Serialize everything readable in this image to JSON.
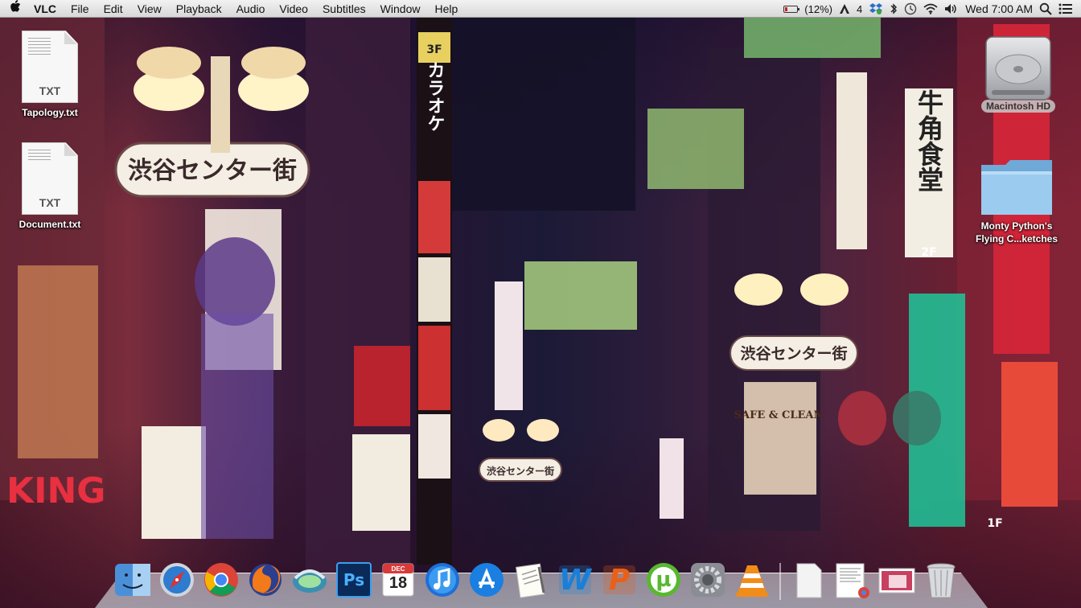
{
  "menubar": {
    "apple_icon": "apple-logo-icon",
    "app_name": "VLC",
    "menus": [
      "File",
      "Edit",
      "View",
      "Playback",
      "Audio",
      "Video",
      "Subtitles",
      "Window",
      "Help"
    ],
    "status": {
      "battery_text": "(12%)",
      "adobe_count": "4",
      "clock": "Wed 7:00 AM"
    }
  },
  "desktop": {
    "files": [
      {
        "ext": "TXT",
        "name": "Tapology.txt"
      },
      {
        "ext": "TXT",
        "name": "Document.txt"
      }
    ],
    "drive": {
      "name": "Macintosh HD"
    },
    "folder": {
      "name_line1": "Monty Python's",
      "name_line2": "Flying C...ketches"
    }
  },
  "wallpaper": {
    "sign_main": "渋谷センター街",
    "sign_karaoke": "カラオケ",
    "sign_safe_clean": "SAFE & CLEAN",
    "sign_king": "KING",
    "sign_gyukaku": "牛角食堂",
    "sign_2f": "2F",
    "sign_3f": "3F",
    "sign_1f": "1F"
  },
  "dock": {
    "apps": [
      "finder-icon",
      "safari-icon",
      "chrome-icon",
      "firefox-icon",
      "sync-icon",
      "photoshop-icon",
      "calendar-icon",
      "itunes-icon",
      "app-store-icon",
      "text-edit-icon",
      "word-icon",
      "powerpoint-icon",
      "utorrent-icon",
      "system-preferences-icon",
      "vlc-icon"
    ],
    "calendar_month": "DEC",
    "calendar_day": "18",
    "ps_label": "Ps",
    "word_label": "W",
    "ppt_label": "P",
    "utorrent_label": "µ",
    "stacks": [
      "document-stack-icon",
      "downloads-stack-icon",
      "photos-stack-icon",
      "trash-icon"
    ]
  }
}
